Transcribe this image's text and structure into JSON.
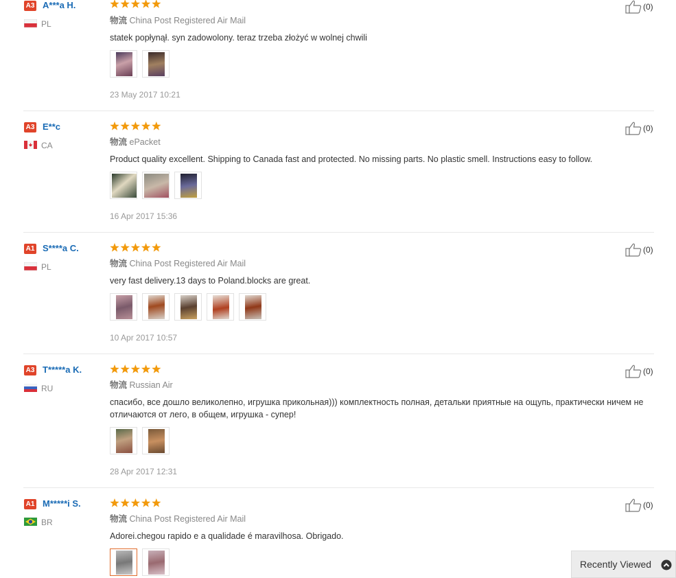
{
  "colors": {
    "accent_link": "#1a6bb5",
    "badge_red": "#e0442a",
    "star_orange": "#f29a0c",
    "active_thumb_border": "#e06a2a"
  },
  "reviews": [
    {
      "badge": "A3",
      "user": "A***a H.",
      "flag_icon": "poland-flag-icon",
      "country": "PL",
      "rating": 5,
      "shipping_label": "物流",
      "shipping_method": "China Post Registered Air Mail",
      "text": "statek popłynął. syn zadowolony. teraz trzeba złożyć w wolnej chwili",
      "photo_count": 2,
      "date": "23 May 2017 10:21",
      "helpful_count": "(0)"
    },
    {
      "badge": "A3",
      "user": "E**c",
      "flag_icon": "canada-flag-icon",
      "country": "CA",
      "rating": 5,
      "shipping_label": "物流",
      "shipping_method": "ePacket",
      "text": "Product quality excellent. Shipping to Canada fast and protected. No missing parts. No plastic smell. Instructions easy to follow.",
      "photo_count": 3,
      "date": "16 Apr 2017 15:36",
      "helpful_count": "(0)"
    },
    {
      "badge": "A1",
      "user": "S****a C.",
      "flag_icon": "poland-flag-icon",
      "country": "PL",
      "rating": 5,
      "shipping_label": "物流",
      "shipping_method": "China Post Registered Air Mail",
      "text": "very fast delivery.13 days to Poland.blocks are great.",
      "photo_count": 5,
      "date": "10 Apr 2017 10:57",
      "helpful_count": "(0)"
    },
    {
      "badge": "A3",
      "user": "T*****a K.",
      "flag_icon": "russia-flag-icon",
      "country": "RU",
      "rating": 5,
      "shipping_label": "物流",
      "shipping_method": "Russian Air",
      "text": "спасибо, все дошло великолепно, игрушка прикольная))) комплектность полная, детальки приятные на ощупь, практически ничем не отличаются от лего, в общем, игрушка - супер!",
      "photo_count": 2,
      "date": "28 Apr 2017 12:31",
      "helpful_count": "(0)"
    },
    {
      "badge": "A1",
      "user": "M*****i S.",
      "flag_icon": "brazil-flag-icon",
      "country": "BR",
      "rating": 5,
      "shipping_label": "物流",
      "shipping_method": "China Post Registered Air Mail",
      "text": "Adorei.chegou rapido e a qualidade é maravilhosa. Obrigado.",
      "photo_count": 2,
      "date": "",
      "helpful_count": "(0)"
    }
  ],
  "recently_viewed": {
    "label": "Recently Viewed",
    "icon": "chevron-up-circle-icon"
  }
}
